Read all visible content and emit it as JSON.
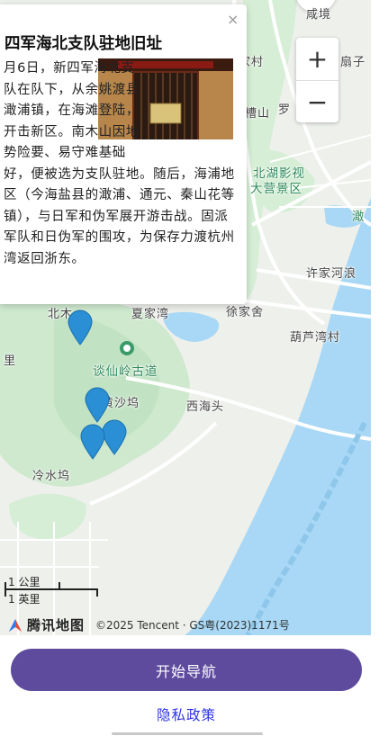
{
  "map": {
    "labels": {
      "dongxiao": "东溪村",
      "xiancun": "咸境",
      "jiacun": "家村",
      "shanzi": "扇子",
      "caoshan": "槽山",
      "luo": "罗",
      "beihu": "北湖影视",
      "dayingqu": "大营景区",
      "ao": "澉",
      "xujia": "许家河浪",
      "beimu": "北木",
      "xiajiawan": "夏家湾",
      "xujiashe": "徐家舍",
      "hulu": "葫芦湾村",
      "li": "里",
      "tanxian": "谈仙岭古道",
      "huangshawu": "黄沙坞",
      "xihaitou": "西海头",
      "lengshuiwu": "冷水坞"
    },
    "zoom_in": "+",
    "zoom_out": "−",
    "scale_km": "1 公里",
    "scale_mile": "1 英里",
    "brand_name": "腾讯地图",
    "copyright": "©2025 Tencent · GS粤(2023)1171号",
    "colors": {
      "water": "#a8d8f5",
      "green": "#cfe9cf",
      "road": "#ffffff",
      "pin": "#2a8fd4"
    }
  },
  "popup": {
    "close_label": "×",
    "title": "四军海北支队驻地旧址",
    "body": "月6日，新四军海北支队在队下，从余姚渡县澉浦镇，在海滩登陆，开击新区。南木山因地势险要、易守难基础好，便被选为支队驻地。随后，海浦地区（今海盐县的澉浦、通元、秦山花等镇），与日军和伪军展开游击战。固派军队和日伪军的围攻，为保存力渡杭州湾返回浙东。"
  },
  "actions": {
    "navigate": "开始导航",
    "privacy": "隐私政策"
  }
}
